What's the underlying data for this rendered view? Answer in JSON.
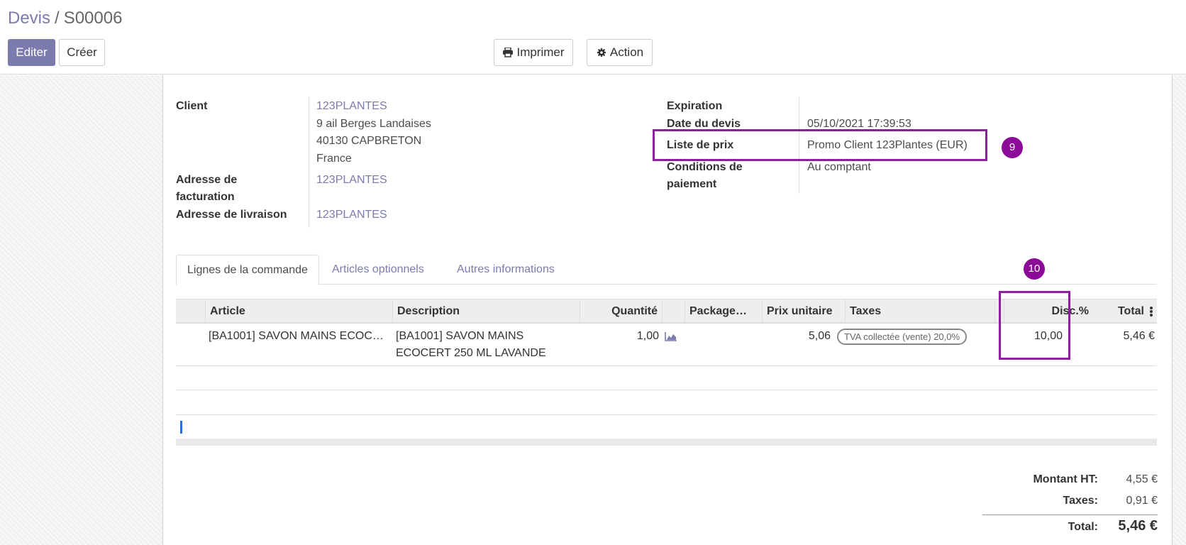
{
  "breadcrumb": {
    "parent": "Devis",
    "separator": "/",
    "current": "S00006"
  },
  "buttons": {
    "edit": "Editer",
    "create": "Créer",
    "print": "Imprimer",
    "action": "Action"
  },
  "form": {
    "client_label": "Client",
    "client_name": "123PLANTES",
    "address_line1": "9 ail Berges Landaises",
    "address_line2": "40130 CAPBRETON",
    "address_line3": "France",
    "invoice_label_1": "Adresse de",
    "invoice_label_2": "facturation",
    "invoice_value": "123PLANTES",
    "delivery_label": "Adresse de livraison",
    "delivery_value": "123PLANTES",
    "expiration_label": "Expiration",
    "quote_date_label": "Date du devis",
    "quote_date_value": "05/10/2021 17:39:53",
    "pricelist_label": "Liste de prix",
    "pricelist_value": "Promo Client 123Plantes (EUR)",
    "payment_label_1": "Conditions de",
    "payment_label_2": "paiement",
    "payment_value": "Au comptant"
  },
  "tabs": [
    "Lignes de la commande",
    "Articles optionnels",
    "Autres informations"
  ],
  "table": {
    "columns": [
      "Article",
      "Description",
      "Quantité",
      "Package…",
      "Prix unitaire",
      "Taxes",
      "Disc.%",
      "Total"
    ],
    "rows": [
      {
        "article": "[BA1001] SAVON MAINS ECOC…",
        "description_1": "[BA1001] SAVON MAINS",
        "description_2": "ECOCERT 250 ML LAVANDE",
        "quantity": "1,00",
        "unit_price": "5,06",
        "tax": "TVA collectée (vente) 20,0%",
        "discount": "10,00",
        "total": "5,46 €"
      }
    ]
  },
  "totals": {
    "untaxed_label": "Montant HT:",
    "untaxed_value": "4,55 €",
    "taxes_label": "Taxes:",
    "taxes_value": "0,91 €",
    "total_label": "Total:",
    "total_value": "5,46 €"
  },
  "annotations": {
    "bubble_pricelist": "9",
    "bubble_discount": "10"
  },
  "colors": {
    "primary": "#7c7bad",
    "annotation": "#8c1f9b",
    "link": "#7c7bad"
  },
  "icons": {
    "print": "printer-icon",
    "action": "gear-icon",
    "forecast": "area-chart-icon",
    "columns": "kebab-menu-icon"
  }
}
